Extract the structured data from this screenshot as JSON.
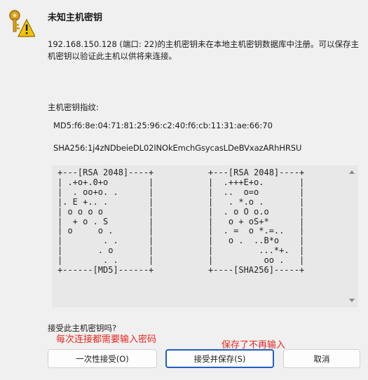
{
  "dialog": {
    "title": "未知主机密钥",
    "message": "192.168.150.128 (端口: 22)的主机密钥未在本地主机密钥数据库中注册。可以保存主机密钥以验证此主机以供将来连接。",
    "fingerprint_label": "主机密钥指纹:",
    "md5": "MD5:f6:8e:04:71:81:25:96:c2:40:f6:cb:11:31:ae:66:70",
    "sha256": "SHA256:1j4zNDbeieDL02lNOkEmchGsycasLDeBVxazARhHRSU",
    "randomart_md5": "+---[RSA 2048]----+\n| .+o+.0+o        |\n|  . oo+o. .      |\n|. E +.. .        |\n| o o o o         |\n|  + o . S        |\n| o     o .       |\n|        . .      |\n|       . o       |\n|        . .      |\n+------[MD5]------+",
    "randomart_sha256": "+---[RSA 2048]----+\n|  .+++E+o.       |\n|  ..  o=o        |\n|   . *.o .       |\n|  . o O o.o      |\n|   o + oS+*      |\n|  . =  o *.=..   |\n|   o .  ..B*o    |\n|         ...*+.  |\n|          oo .   |\n+----[SHA256]-----+",
    "question": "接受此主机密钥吗?",
    "buttons": {
      "accept_once": "一次性接受(O)",
      "accept_save": "接受并保存(S)",
      "cancel": "取消"
    }
  },
  "annotations": {
    "left": "每次连接都需要输入密码",
    "right": "保存了不再输入"
  },
  "colors": {
    "annotation": "#e8271f",
    "default_button_border": "#1f5fbf"
  }
}
